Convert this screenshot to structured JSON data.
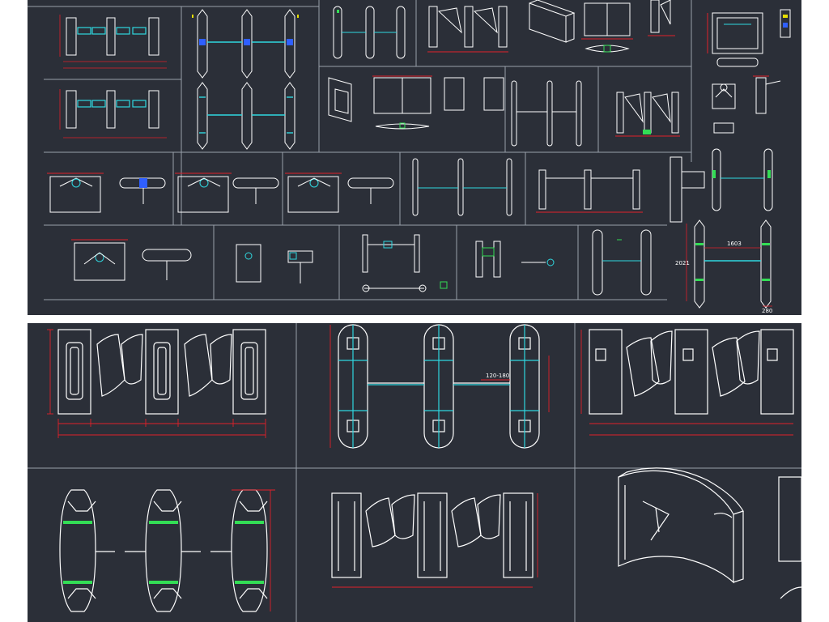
{
  "labels": {
    "dim_1603": "1603",
    "dim_2021": "2021",
    "dim_280": "280",
    "dim_120_180": "120-180"
  },
  "colors": {
    "background_page": "#ffffff",
    "drawing_background": "#2b2f38",
    "frame_line": "#9aa0aa",
    "outline": "#ffffff",
    "dimension_line": "#e0202a",
    "cyan_highlight": "#2fd8e0",
    "green_highlight": "#33dd55",
    "yellow_text": "#e8e000",
    "blue_highlight": "#2f5fff"
  },
  "icons": [
    "tripod-turnstile-icon",
    "swing-gate-icon",
    "flap-barrier-icon",
    "wing-gate-icon"
  ]
}
